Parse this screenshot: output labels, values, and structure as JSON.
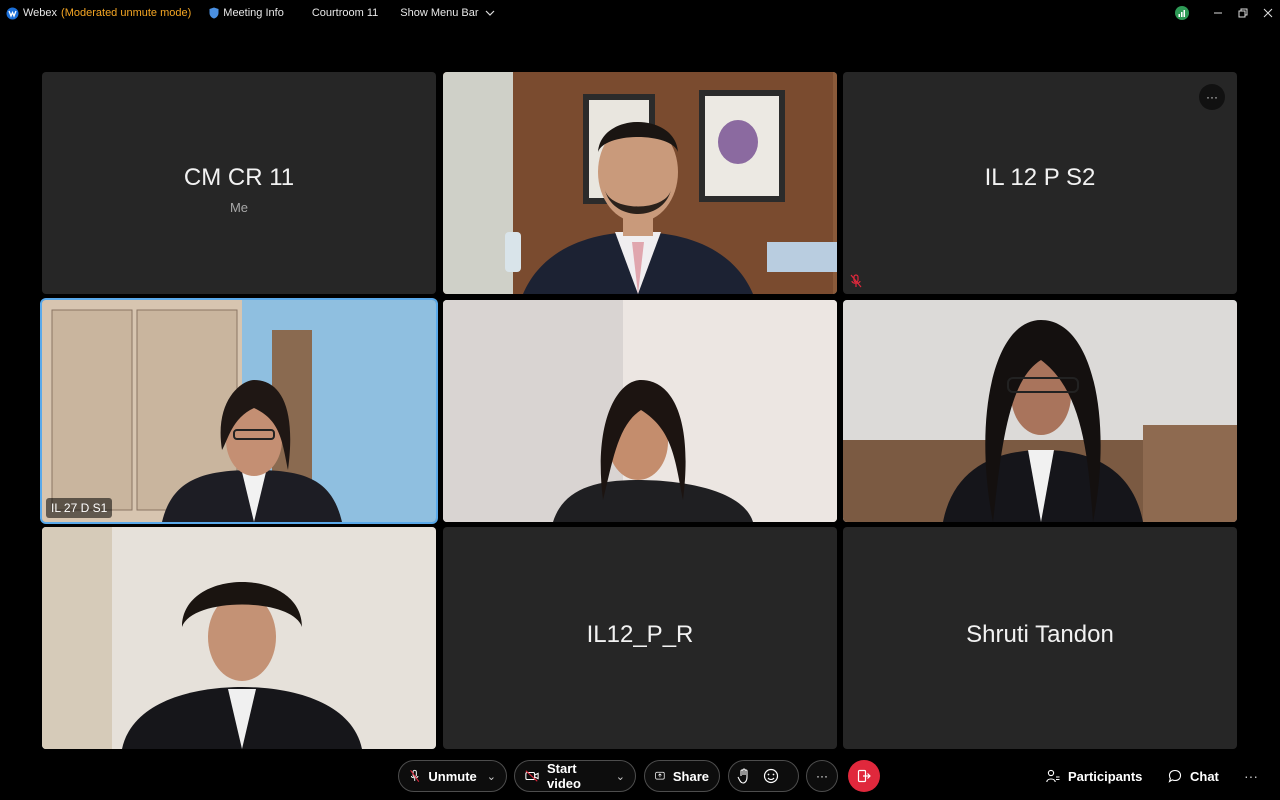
{
  "titlebar": {
    "app_name": "Webex",
    "mode": "(Moderated unmute mode)",
    "meeting_info": "Meeting Info",
    "meeting_name": "Courtroom 11",
    "show_menu_bar": "Show Menu Bar"
  },
  "tiles": [
    {
      "name": "CM CR 11",
      "subtitle": "Me",
      "video": false
    },
    {
      "name": "",
      "video": true
    },
    {
      "name": "IL 12 P S2",
      "video": false,
      "muted": true
    },
    {
      "name": "IL 27 D S1",
      "video": true,
      "active": true
    },
    {
      "name": "",
      "video": true
    },
    {
      "name": "",
      "video": true
    },
    {
      "name": "",
      "video": true
    },
    {
      "name": "IL12_P_R",
      "video": false
    },
    {
      "name": "Shruti Tandon",
      "video": false
    }
  ],
  "toolbar": {
    "unmute": "Unmute",
    "start_video": "Start video",
    "share": "Share",
    "participants": "Participants",
    "chat": "Chat"
  },
  "colors": {
    "accent_mode": "#f5a623",
    "leave_red": "#e0283c",
    "active_border": "#5aa9ea",
    "tile_bg": "#262626"
  }
}
